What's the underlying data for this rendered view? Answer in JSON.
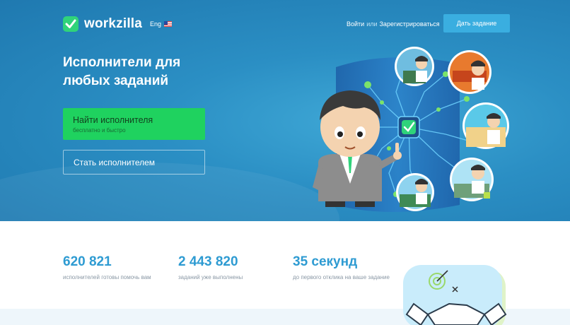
{
  "header": {
    "logo_text": "workzilla",
    "lang_label": "Eng",
    "login_label": "Войти",
    "or_label": "или",
    "register_label": "Зарегистрироваться",
    "give_task_label": "Дать задание"
  },
  "hero": {
    "headline_line1": "Исполнители для",
    "headline_line2": "любых заданий",
    "find_button_title": "Найти исполнителя",
    "find_button_subtitle": "бесплатно и быстро",
    "become_button_label": "Стать исполнителем"
  },
  "stats": [
    {
      "value": "620 821",
      "label": "исполнителей готовы помочь вам"
    },
    {
      "value": "2 443 820",
      "label": "заданий уже выполнены"
    },
    {
      "value": "35 секунд",
      "label": "до первого отклика на ваше задание"
    }
  ],
  "colors": {
    "hero_blue": "#2b8fc4",
    "accent_green": "#1fd25f",
    "stat_blue": "#2e9bd2",
    "task_button": "#3aaee0"
  }
}
